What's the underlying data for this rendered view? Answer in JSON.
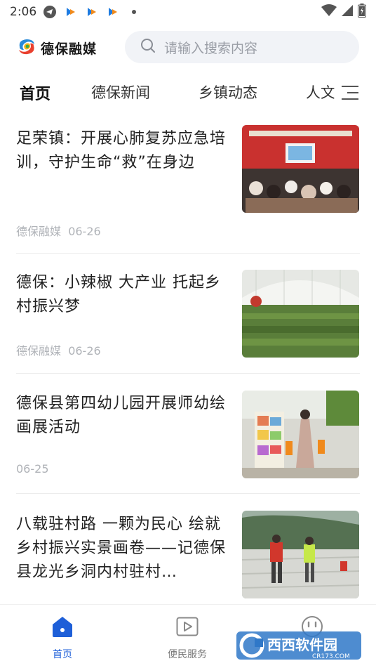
{
  "status_bar": {
    "time": "2:06",
    "icons": [
      "telegram-icon",
      "app-notification-icon",
      "app-notification-icon",
      "app-notification-icon",
      "dot-icon"
    ],
    "right_icons": [
      "wifi-icon",
      "signal-icon",
      "battery-icon"
    ]
  },
  "header": {
    "logo_text": "德保融媒",
    "search_placeholder": "请输入搜索内容"
  },
  "tabs": [
    {
      "label": "首页",
      "active": true
    },
    {
      "label": "德保新闻",
      "active": false
    },
    {
      "label": "乡镇动态",
      "active": false
    },
    {
      "label": "人文",
      "active": false
    }
  ],
  "news": [
    {
      "title": "足荣镇：开展心肺复苏应急培训，守护生命“救”在身边",
      "source": "德保融媒",
      "date": "06-26",
      "thumb": "training-classroom-photo"
    },
    {
      "title": "德保：小辣椒 大产业 托起乡村振兴梦",
      "source": "德保融媒",
      "date": "06-26",
      "thumb": "greenhouse-pepper-photo"
    },
    {
      "title": "德保县第四幼儿园开展师幼绘画展活动",
      "source": "",
      "date": "06-25",
      "thumb": "kindergarten-exhibition-photo"
    },
    {
      "title": "八载驻村路 一颗为民心 绘就乡村振兴实景画卷——记德保县龙光乡洞内村驻村…",
      "source": "",
      "date": "",
      "thumb": "village-field-photo"
    }
  ],
  "bottom_nav": [
    {
      "label": "首页",
      "icon": "home-icon",
      "active": true
    },
    {
      "label": "便民服务",
      "icon": "play-icon",
      "active": false
    },
    {
      "label": "",
      "icon": "smile-icon",
      "active": false
    }
  ],
  "watermark": {
    "text": "西西软件园",
    "subtext": "CR173.COM"
  },
  "colors": {
    "accent": "#1e5fd8",
    "meta": "#b0b3b8",
    "search_bg": "#f1f3f7"
  }
}
